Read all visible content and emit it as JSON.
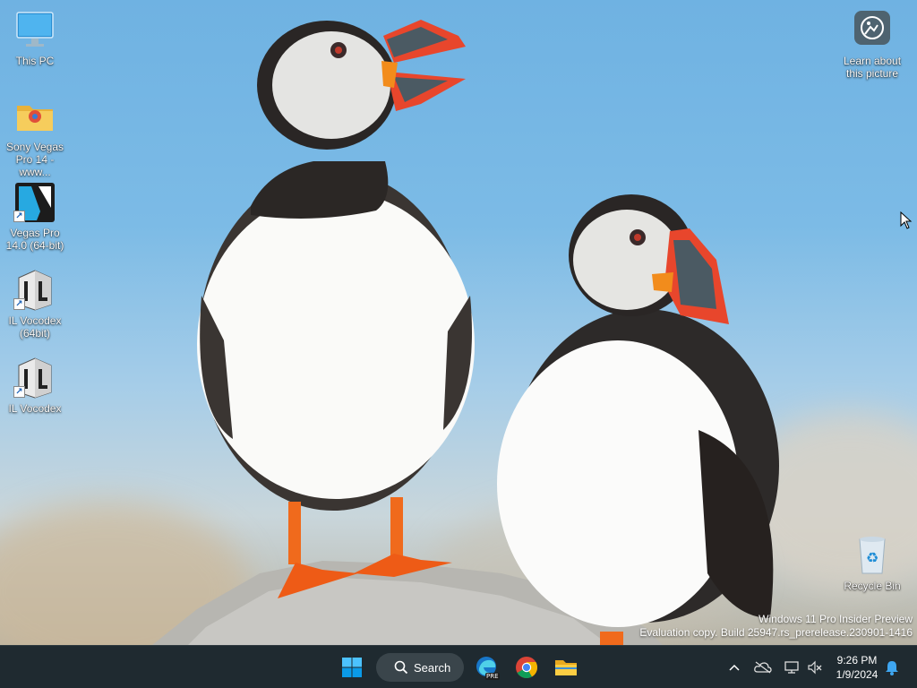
{
  "desktop": {
    "icons": [
      {
        "id": "this-pc",
        "label": "This PC"
      },
      {
        "id": "sony-vegas-folder",
        "label": "Sony Vegas Pro 14 - www..."
      },
      {
        "id": "vegas-pro",
        "label": "Vegas Pro 14.0 (64-bit)"
      },
      {
        "id": "il-vocodex-64",
        "label": "IL Vocodex (64bit)"
      },
      {
        "id": "il-vocodex",
        "label": "IL Vocodex"
      }
    ],
    "learn": {
      "label": "Learn about this picture"
    },
    "recycle": {
      "label": "Recycle Bin"
    },
    "watermark": {
      "line1": "Windows 11 Pro Insider Preview",
      "line2": "Evaluation copy. Build 25947.rs_prerelease.230901-1416"
    }
  },
  "taskbar": {
    "search_label": "Search",
    "edge_badge": "PRE",
    "clock": {
      "time": "9:26 PM",
      "date": "1/9/2024"
    }
  },
  "colors": {
    "taskbar_bg": "#1f2a30",
    "accent": "#0078d4"
  }
}
